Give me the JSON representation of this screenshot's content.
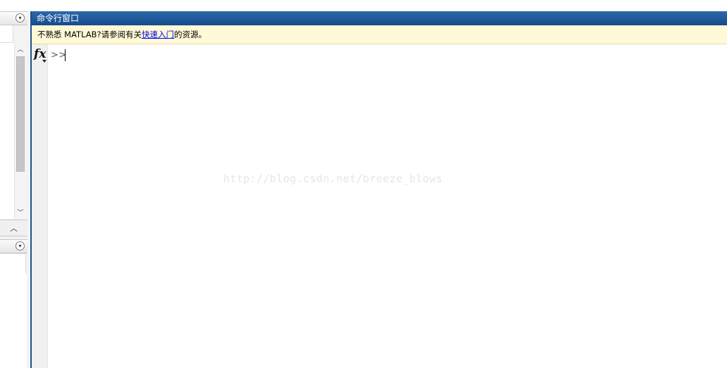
{
  "command_window": {
    "title": "命令行窗口",
    "info_prefix": "不熟悉 MATLAB?请参阅有关",
    "info_link": "快速入门",
    "info_suffix": "的资源。",
    "fx_label": "fx",
    "prompt": ">>"
  },
  "watermark": "http://blog.csdn.net/breeze_blows",
  "left_panel": {
    "panel1_dropdown_icon": "chevron-down-circle-icon",
    "panel2_dropdown_icon": "chevron-down-circle-icon",
    "collapse_icon": "chevron-up-icon"
  },
  "colors": {
    "title_bar": "#1d4e8c",
    "info_bar": "#fff9d7",
    "link": "#0000ee"
  }
}
